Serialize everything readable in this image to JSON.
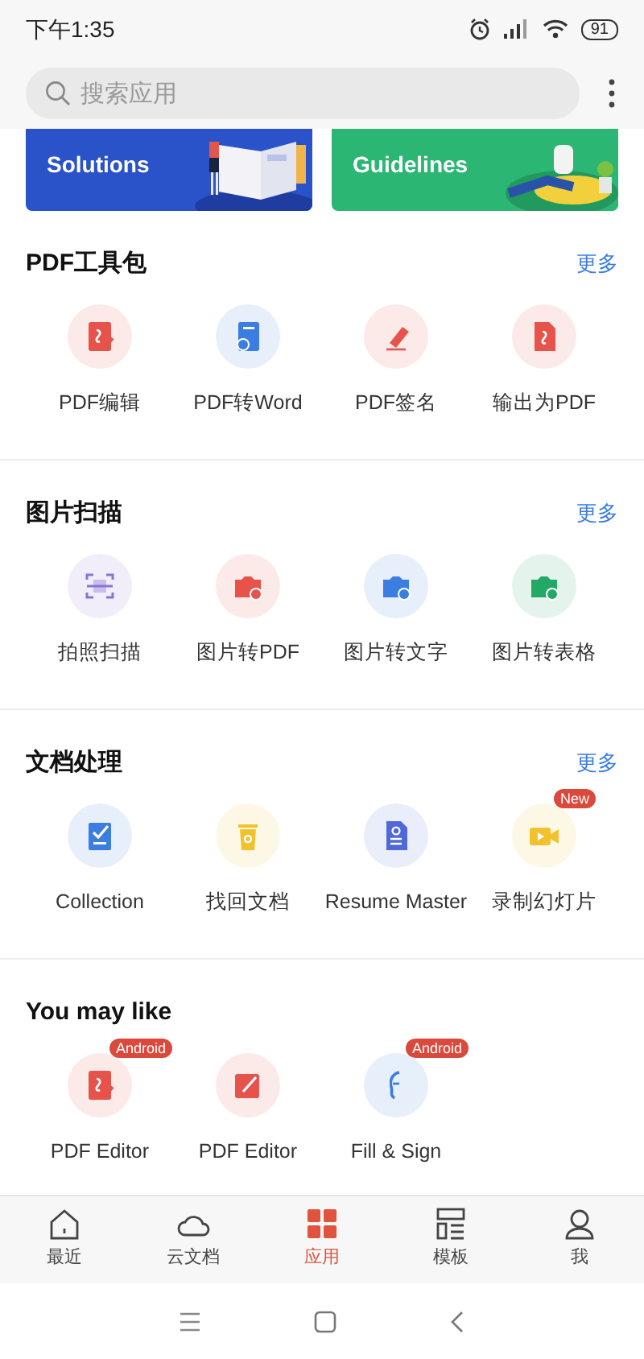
{
  "status_bar": {
    "time": "下午1:35",
    "battery": "91"
  },
  "search": {
    "placeholder": "搜索应用"
  },
  "banners": [
    {
      "title": "Solutions",
      "color": "#2a52c9"
    },
    {
      "title": "Guidelines",
      "color": "#2bb673"
    }
  ],
  "sections": [
    {
      "title": "PDF工具包",
      "more": "更多",
      "tools": [
        {
          "label": "PDF编辑",
          "kind": "edit",
          "color": "#e5534b"
        },
        {
          "label": "PDF转Word",
          "kind": "word",
          "color": "#3b7de0"
        },
        {
          "label": "PDF签名",
          "kind": "sign",
          "color": "#e5534b"
        },
        {
          "label": "输出为PDF",
          "kind": "export",
          "color": "#e5534b"
        }
      ]
    },
    {
      "title": "图片扫描",
      "more": "更多",
      "tools": [
        {
          "label": "拍照扫描",
          "kind": "scan",
          "color": "#8b72d6"
        },
        {
          "label": "图片转PDF",
          "kind": "camera",
          "color": "#e5534b"
        },
        {
          "label": "图片转文字",
          "kind": "camera",
          "color": "#3b7de0"
        },
        {
          "label": "图片转表格",
          "kind": "camera",
          "color": "#24a866"
        }
      ]
    },
    {
      "title": "文档处理",
      "more": "更多",
      "tools": [
        {
          "label": "Collection",
          "kind": "check",
          "color": "#3b7de0"
        },
        {
          "label": "找回文档",
          "kind": "bin",
          "color": "#f2c22e"
        },
        {
          "label": "Resume Master",
          "kind": "resume",
          "color": "#5068d8"
        },
        {
          "label": "录制幻灯片",
          "kind": "video",
          "color": "#f2c22e",
          "badge": "New"
        }
      ]
    },
    {
      "title": "You may like",
      "tools": [
        {
          "label": "PDF Editor",
          "kind": "edit",
          "color": "#e5534b",
          "badge": "Android"
        },
        {
          "label": "PDF Editor",
          "kind": "pen",
          "color": "#e5534b"
        },
        {
          "label": "Fill & Sign",
          "kind": "quill",
          "color": "#3b7de0",
          "badge": "Android"
        }
      ]
    }
  ],
  "tab_bar": [
    {
      "label": "最近",
      "selected": false
    },
    {
      "label": "云文档",
      "selected": false
    },
    {
      "label": "应用",
      "selected": true
    },
    {
      "label": "模板",
      "selected": false
    },
    {
      "label": "我",
      "selected": false
    }
  ]
}
